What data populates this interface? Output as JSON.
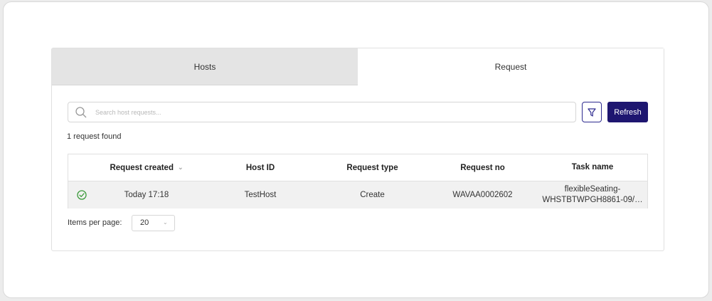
{
  "tabs": [
    {
      "label": "Hosts",
      "active": false
    },
    {
      "label": "Request",
      "active": true
    }
  ],
  "search": {
    "placeholder": "Search host requests...",
    "value": ""
  },
  "toolbar": {
    "filter_icon": "filter-icon",
    "refresh_label": "Refresh"
  },
  "results": {
    "count_text": "1 request found"
  },
  "table": {
    "columns": [
      "Request created",
      "Host ID",
      "Request type",
      "Request no",
      "Task name"
    ],
    "sorted_column": "Request created",
    "rows": [
      {
        "status_icon": "check-circle-icon",
        "status_color": "#3a9a3a",
        "request_created": "Today 17:18",
        "host_id": "TestHost",
        "request_type": "Create",
        "request_no": "WAVAA0002602",
        "task_name_line1": "flexibleSeating-",
        "task_name_line2": "WHSTBTWPGH8861-09/…"
      }
    ]
  },
  "pagination": {
    "items_per_page_label": "Items per page:",
    "items_per_page_value": "20"
  },
  "colors": {
    "accent": "#1e1670",
    "border": "#d6d6d6",
    "row_bg": "#f1f1f1",
    "inactive_tab": "#e4e4e4"
  }
}
